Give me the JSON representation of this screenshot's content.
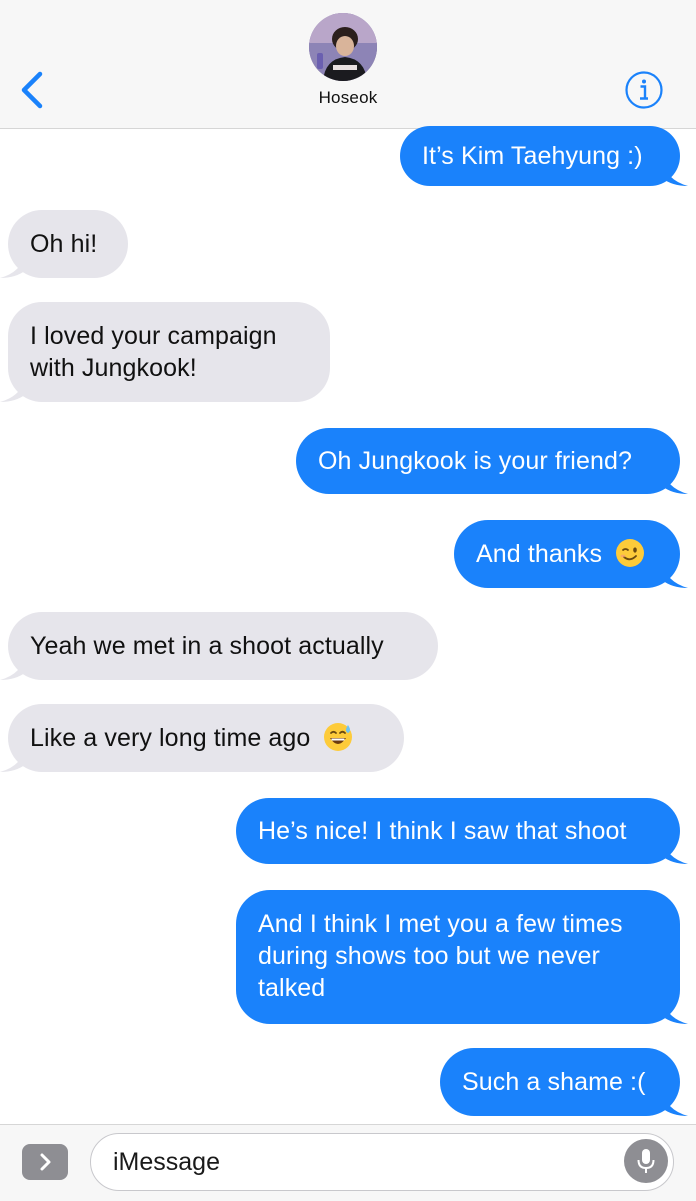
{
  "header": {
    "contact_name": "Hoseok",
    "accent_color": "#1a82fb"
  },
  "messages": [
    {
      "direction": "outgoing",
      "text": "It’s Kim Taehyung :)"
    },
    {
      "direction": "incoming",
      "text": "Oh hi!"
    },
    {
      "direction": "incoming",
      "text": "I loved your campaign with Jungkook!"
    },
    {
      "direction": "outgoing",
      "text": "Oh Jungkook is your friend?"
    },
    {
      "direction": "outgoing",
      "text": "And thanks",
      "emoji": "winking-face"
    },
    {
      "direction": "incoming",
      "text": "Yeah we met in a shoot actually"
    },
    {
      "direction": "incoming",
      "text": "Like a very long time ago",
      "emoji": "grinning-face-with-sweat"
    },
    {
      "direction": "outgoing",
      "text": "He’s nice! I think I saw that shoot"
    },
    {
      "direction": "outgoing",
      "text": "And I think I met you a few times during shows too but we never talked"
    },
    {
      "direction": "outgoing",
      "text": "Such a shame :("
    }
  ],
  "composer": {
    "placeholder": "iMessage"
  },
  "colors": {
    "outgoing_bubble": "#1a82fb",
    "incoming_bubble": "#e6e5eb",
    "bar_background": "#f7f7f7"
  }
}
